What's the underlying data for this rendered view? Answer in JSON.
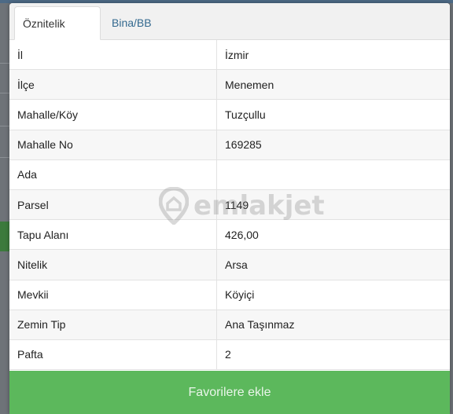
{
  "tabs": {
    "active": "Öznitelik Bilgisi",
    "inactive": "Bina/BB Listesi"
  },
  "rows": [
    {
      "label": "İl",
      "value": "İzmir"
    },
    {
      "label": "İlçe",
      "value": "Menemen"
    },
    {
      "label": "Mahalle/Köy",
      "value": "Tuzçullu"
    },
    {
      "label": "Mahalle No",
      "value": "169285"
    },
    {
      "label": "Ada",
      "value": ""
    },
    {
      "label": "Parsel",
      "value": "1149"
    },
    {
      "label": "Tapu Alanı",
      "value": "426,00"
    },
    {
      "label": "Nitelik",
      "value": "Arsa"
    },
    {
      "label": "Mevkii",
      "value": "Köyiçi"
    },
    {
      "label": "Zemin Tip",
      "value": "Ana Taşınmaz"
    },
    {
      "label": "Pafta",
      "value": "2"
    }
  ],
  "watermark": {
    "text": "emlakjet"
  },
  "footer": {
    "button_label": "Favorilere ekle"
  },
  "colors": {
    "accent_green": "#5cb85c",
    "tab_link": "#33698f"
  }
}
